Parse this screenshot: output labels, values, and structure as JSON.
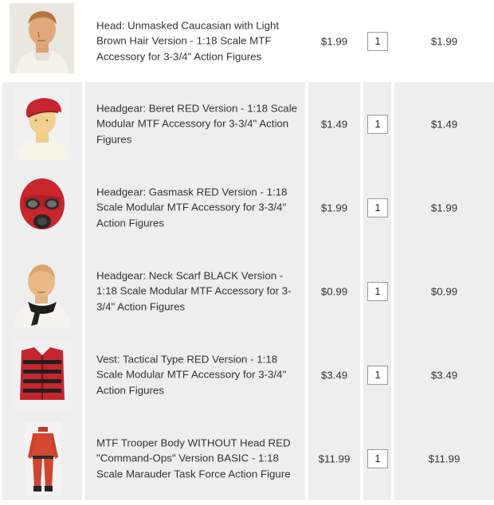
{
  "cart": {
    "items": [
      {
        "name": "Head: Unmasked Caucasian with Light Brown Hair Version - 1:18 Scale MTF Accessory for 3-3/4\" Action Figures",
        "price": "$1.99",
        "qty": "1",
        "total": "$1.99",
        "image_icon": "head-figure-icon"
      },
      {
        "name": "Headgear: Beret RED Version - 1:18 Scale Modular MTF Accessory for 3-3/4\" Action Figures",
        "price": "$1.49",
        "qty": "1",
        "total": "$1.49",
        "image_icon": "beret-icon"
      },
      {
        "name": "Headgear: Gasmask RED Version - 1:18 Scale Modular MTF Accessory for 3-3/4\" Action Figures",
        "price": "$1.99",
        "qty": "1",
        "total": "$1.99",
        "image_icon": "gasmask-icon"
      },
      {
        "name": "Headgear: Neck Scarf BLACK Version - 1:18 Scale Modular MTF Accessory for 3-3/4\" Action Figures",
        "price": "$0.99",
        "qty": "1",
        "total": "$0.99",
        "image_icon": "neck-scarf-icon"
      },
      {
        "name": "Vest: Tactical Type RED Version - 1:18 Scale Modular MTF Accessory for 3-3/4\" Action Figures",
        "price": "$3.49",
        "qty": "1",
        "total": "$3.49",
        "image_icon": "vest-icon"
      },
      {
        "name": "MTF Trooper Body WITHOUT Head RED \"Command-Ops\" Version BASIC - 1:18 Scale Marauder Task Force Action Figure",
        "price": "$11.99",
        "qty": "1",
        "total": "$11.99",
        "image_icon": "figure-body-icon"
      }
    ]
  }
}
